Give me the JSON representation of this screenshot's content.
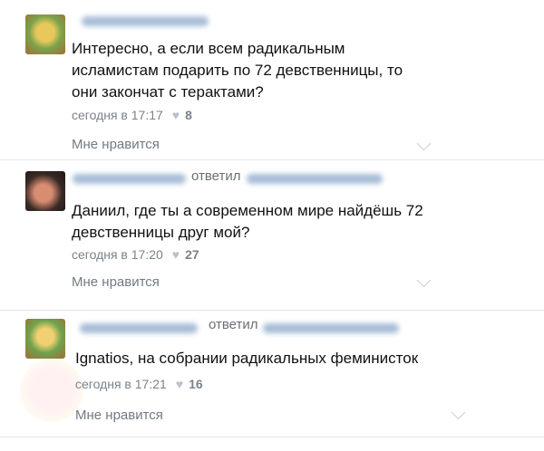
{
  "comments": [
    {
      "text": "Интересно, а если всем радикальным\nисламистам подарить по 72 девственницы, то\nони закончат с терактами?",
      "time": "сегодня в 17:17",
      "likes": "8",
      "like_label": "Мне нравится"
    },
    {
      "replied_label": "ответил",
      "text": "Даниил, где ты а современном мире найдёшь 72\nдевственницы друг мой?",
      "time": "сегодня в 17:20",
      "likes": "27",
      "like_label": "Мне нравится"
    },
    {
      "replied_label": "ответил",
      "text": "Ignatios, на собрании радикальных феминисток",
      "time": "сегодня в 17:21",
      "likes": "16",
      "like_label": "Мне нравится"
    }
  ],
  "icons": {
    "heart": "heart-icon",
    "chevron": "chevron-down-icon"
  },
  "colors": {
    "link_blur": "#9db6d2",
    "muted": "#7b828a",
    "divider": "#e3e6ea"
  }
}
